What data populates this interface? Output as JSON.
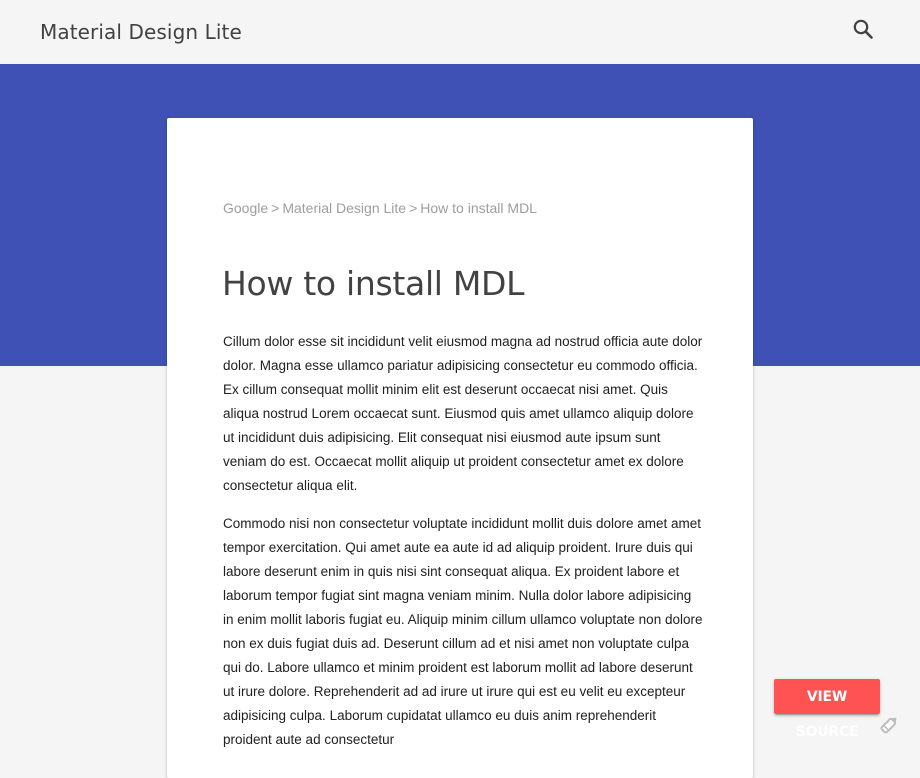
{
  "header": {
    "title": "Material Design Lite",
    "search_icon": "search-icon"
  },
  "colors": {
    "ribbon": "#3f51b5",
    "accent_button": "#ff5252",
    "page_background": "#f5f5f5"
  },
  "breadcrumb": {
    "items": [
      "Google",
      "Material Design Lite",
      "How to install MDL"
    ],
    "separator": ">"
  },
  "article": {
    "title": "How to install MDL",
    "paragraphs": [
      "Cillum dolor esse sit incididunt velit eiusmod magna ad nostrud officia aute dolor dolor. Magna esse ullamco pariatur adipisicing consectetur eu commodo officia. Ex cillum consequat mollit minim elit est deserunt occaecat nisi amet. Quis aliqua nostrud Lorem occaecat sunt. Eiusmod quis amet ullamco aliquip dolore ut incididunt duis adipisicing. Elit consequat nisi eiusmod aute ipsum sunt veniam do est. Occaecat mollit aliquip ut proident consectetur amet ex dolore consectetur aliqua elit.",
      "Commodo nisi non consectetur voluptate incididunt mollit duis dolore amet amet tempor exercitation. Qui amet aute ea aute id ad aliquip proident. Irure duis qui labore deserunt enim in quis nisi sint consequat aliqua. Ex proident labore et laborum tempor fugiat sint magna veniam minim. Nulla dolor labore adipisicing in enim mollit laboris fugiat eu. Aliquip minim cillum ullamco voluptate non dolore non ex duis fugiat duis ad. Deserunt cillum ad et nisi amet non voluptate culpa qui do. Labore ullamco et minim proident est laborum mollit ad labore deserunt ut irure dolore. Reprehenderit ad ad irure ut irure qui est eu velit eu excepteur adipisicing culpa. Laborum cupidatat ullamco eu duis anim reprehenderit proident aute ad consectetur"
    ]
  },
  "view_source": {
    "label": "VIEW SOURCE",
    "edit_icon": "pencil-icon"
  }
}
